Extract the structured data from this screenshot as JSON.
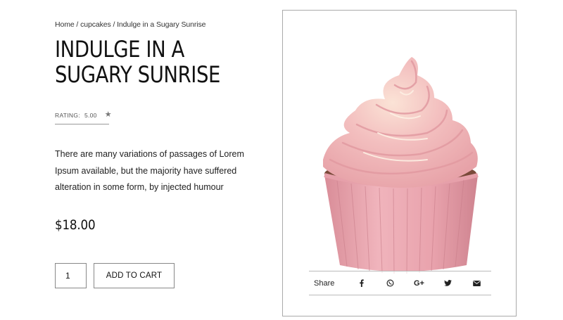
{
  "breadcrumb": {
    "home": "Home",
    "sep1": " / ",
    "category": "cupcakes",
    "sep2": " / ",
    "current": "Indulge in a Sugary Sunrise"
  },
  "product": {
    "title_line1": "INDULGE IN A",
    "title_line2": "SUGARY SUNRISE",
    "rating_label": "RATING:",
    "rating_value": "5.00",
    "description": "There are many variations of passages of Lorem Ipsum available, but the majority have suffered alteration in some form, by injected humour",
    "price": "$18.00"
  },
  "cart": {
    "quantity": "1",
    "add_label": "ADD TO CART"
  },
  "share": {
    "label": "Share",
    "icons": [
      "facebook-icon",
      "whatsapp-icon",
      "google-plus-icon",
      "twitter-icon",
      "email-icon"
    ],
    "google_plus_text": "G+"
  },
  "colors": {
    "frosting": "#f2b6b8",
    "liner": "#e9a3ad",
    "cake": "#7a4a3a",
    "icon": "#222222"
  }
}
